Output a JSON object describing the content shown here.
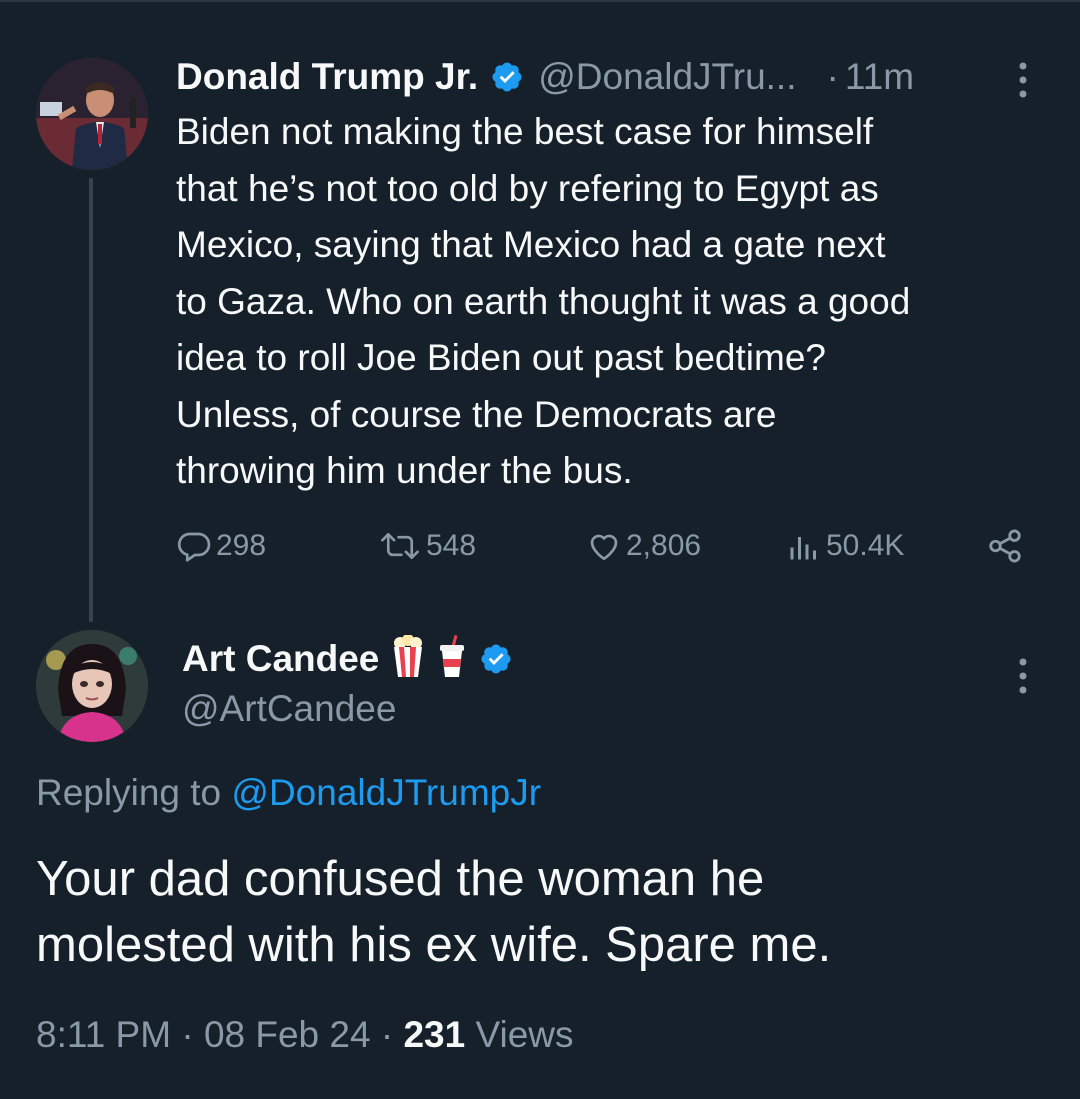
{
  "colors": {
    "background": "#15202b",
    "text_primary": "#f7f9f9",
    "text_secondary": "#8b98a5",
    "link": "#1d9bf0",
    "verified": "#1d9bf0",
    "thread_line": "#38444d"
  },
  "parent_tweet": {
    "display_name": "Donald Trump Jr.",
    "verified_icon": "verified-badge-icon",
    "handle": "@DonaldJTru...",
    "separator": "·",
    "time": "11m",
    "more_icon": "more-vertical-icon",
    "text_lines": [
      "Biden not making the best case for himself",
      "that he’s not too old by refering to Egypt as",
      "Mexico, saying that Mexico had a gate next",
      "to Gaza. Who on earth thought it was a good",
      "idea to roll Joe Biden out past bedtime?",
      "Unless, of course the Democrats are",
      "throwing him under the bus."
    ],
    "actions": {
      "reply_count": "298",
      "retweet_count": "548",
      "like_count": "2,806",
      "views_count": "50.4K",
      "icons": [
        "reply-icon",
        "retweet-icon",
        "like-icon",
        "views-icon",
        "share-icon"
      ]
    }
  },
  "reply_tweet": {
    "display_name": "Art Candee",
    "emojis": [
      "popcorn-emoji",
      "soda-cup-emoji"
    ],
    "verified_icon": "verified-badge-icon",
    "handle": "@ArtCandee",
    "more_icon": "more-vertical-icon",
    "replying_prefix": "Replying to",
    "replying_mention": "@DonaldJTrumpJr",
    "text_lines": [
      "Your dad confused the woman he",
      "molested with his ex wife. Spare me."
    ],
    "meta": {
      "time": "8:11 PM",
      "sep1": "·",
      "date": "08 Feb 24",
      "sep2": "·",
      "views_count": "231",
      "views_label": "Views"
    }
  }
}
